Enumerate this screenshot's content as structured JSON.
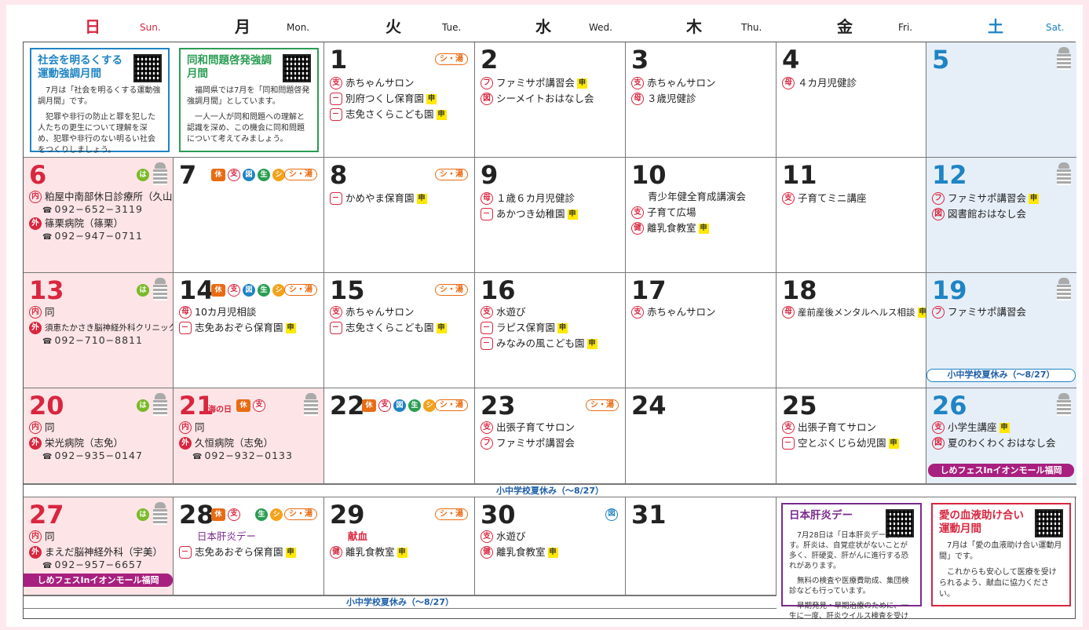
{
  "header": [
    {
      "kanji": "日",
      "en": "Sun.",
      "color": "#d9263f"
    },
    {
      "kanji": "月",
      "en": "Mon.",
      "color": "#222222"
    },
    {
      "kanji": "火",
      "en": "Tue.",
      "color": "#222222"
    },
    {
      "kanji": "水",
      "en": "Wed.",
      "color": "#222222"
    },
    {
      "kanji": "木",
      "en": "Thu.",
      "color": "#222222"
    },
    {
      "kanji": "金",
      "en": "Fri.",
      "color": "#222222"
    },
    {
      "kanji": "土",
      "en": "Sat.",
      "color": "#1f84c4"
    }
  ],
  "info": {
    "shakai": {
      "title": "社会を明るくする運動強調月間",
      "body1": "7月は「社会を明るくする運動強調月間」です。",
      "body2": "犯罪や非行の防止と罪を犯した人たちの更生について理解を深め、犯罪や非行のない明るい社会をつくりしましょう。"
    },
    "dowa": {
      "title": "同和問題啓発強調月間",
      "body1": "福岡県では7月を「同和問題啓発強調月間」としています。",
      "body2": "一人一人が同和問題への理解と認識を深め、この機会に同和問題について考えてみましょう。"
    },
    "kanen": {
      "title": "日本肝炎デー",
      "body1": "7月28日は「日本肝炎デー」です。肝炎は、自覚症状がないことが多く、肝硬変、肝がんに進行する恐れがあります。",
      "body2": "無料の検査や医療費助成、集団検診なども行っています。",
      "body3": "早期発見・早期治療のために、一生に一度、肝炎ウイルス検査を受けましょう。"
    },
    "ketsueki": {
      "title": "愛の血液助け合い運動月間",
      "body1": "7月は「愛の血液助け合い運動月間」です。",
      "body2": "これからも安心して医療を受けられるよう、献血に協力ください。"
    }
  },
  "badges": {
    "shi": "支",
    "fu": "フ",
    "zu": "図",
    "bo": "母",
    "ken": "健",
    "nai": "内",
    "gai": "外",
    "kyu": "休",
    "sei": "生",
    "shii": "シ",
    "ha": "は",
    "shin": "申",
    "sy": "シ・湯"
  },
  "days": {
    "d1": {
      "n": "1",
      "e1": "赤ちゃんサロン",
      "e2": "別府つくし保育園",
      "e3": "志免さくらこども園"
    },
    "d2": {
      "n": "2",
      "e1": "ファミサポ講習会",
      "e2": "シーメイトおはなし会"
    },
    "d3": {
      "n": "3",
      "e1": "赤ちゃんサロン",
      "e2": "３歳児健診"
    },
    "d4": {
      "n": "4",
      "e1": "４カ月児健診"
    },
    "d5": {
      "n": "5"
    },
    "d6": {
      "n": "6",
      "e1": "粕屋中南部休日診療所（久山）",
      "t1": "092−652−3119",
      "e2": "篠栗病院（篠栗）",
      "t2": "092−947−0711"
    },
    "d7": {
      "n": "7"
    },
    "d8": {
      "n": "8",
      "e1": "かめやま保育園"
    },
    "d9": {
      "n": "9",
      "e1": "１歳６カ月児健診",
      "e2": "あかつき幼稚園"
    },
    "d10": {
      "n": "10",
      "e0": "青少年健全育成講演会",
      "e1": "子育て広場",
      "e2": "離乳食教室"
    },
    "d11": {
      "n": "11",
      "e1": "子育てミニ講座"
    },
    "d12": {
      "n": "12",
      "e1": "ファミサポ講習会",
      "e2": "図書館おはなし会"
    },
    "d13": {
      "n": "13",
      "e1": "同",
      "e2": "須恵たかさき脳神経外科クリニック（須恵）",
      "t2": "092−710−8811"
    },
    "d14": {
      "n": "14",
      "e1": "10カ月児相談",
      "e2": "志免あおぞら保育園"
    },
    "d15": {
      "n": "15",
      "e1": "赤ちゃんサロン",
      "e2": "志免さくらこども園"
    },
    "d16": {
      "n": "16",
      "e1": "水遊び",
      "e2": "ラピス保育園",
      "e3": "みなみの風こども園"
    },
    "d17": {
      "n": "17",
      "e1": "赤ちゃんサロン"
    },
    "d18": {
      "n": "18",
      "e1": "産前産後メンタルヘルス相談"
    },
    "d19": {
      "n": "19",
      "e1": "ファミサポ講習会"
    },
    "d20": {
      "n": "20",
      "e1": "同",
      "e2": "栄光病院（志免）",
      "t2": "092−935−0147"
    },
    "d21": {
      "n": "21",
      "hol": "海の日",
      "e1": "同",
      "e2": "久恒病院（志免）",
      "t2": "092−932−0133"
    },
    "d22": {
      "n": "22"
    },
    "d23": {
      "n": "23",
      "e1": "出張子育てサロン",
      "e2": "ファミサポ講習会"
    },
    "d24": {
      "n": "24"
    },
    "d25": {
      "n": "25",
      "e1": "出張子育てサロン",
      "e2": "空とぶくじら幼児園"
    },
    "d26": {
      "n": "26",
      "e1": "小学生講座",
      "e2": "夏のわくわくおはなし会"
    },
    "d27": {
      "n": "27",
      "e1": "同",
      "e2": "まえだ脳神経外科（宇美）",
      "t2": "092−957−6657"
    },
    "d28": {
      "n": "28",
      "e0": "日本肝炎デー",
      "e2": "志免あおぞら保育園"
    },
    "d29": {
      "n": "29",
      "e0": "献血",
      "e2": "離乳食教室"
    },
    "d30": {
      "n": "30",
      "e1": "水遊び",
      "e2": "離乳食教室"
    },
    "d31": {
      "n": "31"
    }
  },
  "notes": {
    "summer": "小中学校夏休み（〜8/27）",
    "fes": "しめフェスInイオンモール福岡"
  },
  "colors": {
    "red": "#d9263f",
    "blue": "#1f84c4",
    "orange": "#e86c14",
    "purple": "#a8207f",
    "green": "#2a9d53"
  }
}
